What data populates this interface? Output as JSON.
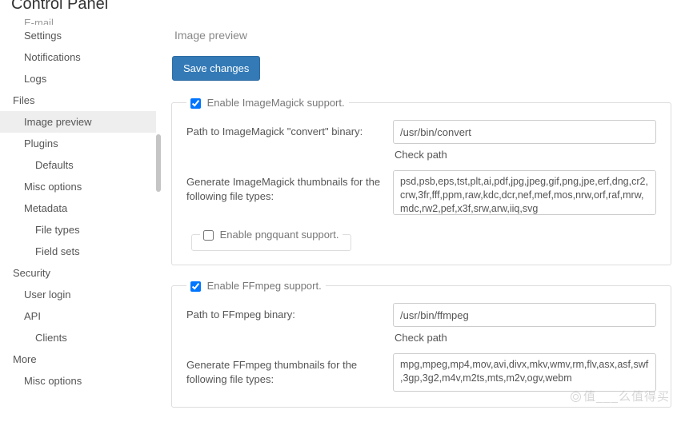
{
  "page": {
    "title": "Control Panel",
    "section": "Image preview"
  },
  "sidebar": {
    "items": [
      {
        "label": "E-mail",
        "kind": "sub",
        "cut": true
      },
      {
        "label": "Settings",
        "kind": "sub"
      },
      {
        "label": "Notifications",
        "kind": "sub"
      },
      {
        "label": "Logs",
        "kind": "sub"
      },
      {
        "label": "Files",
        "kind": "head"
      },
      {
        "label": "Image preview",
        "kind": "sub",
        "active": true
      },
      {
        "label": "Plugins",
        "kind": "sub"
      },
      {
        "label": "Defaults",
        "kind": "sub2"
      },
      {
        "label": "Misc options",
        "kind": "sub"
      },
      {
        "label": "Metadata",
        "kind": "sub"
      },
      {
        "label": "File types",
        "kind": "sub2"
      },
      {
        "label": "Field sets",
        "kind": "sub2"
      },
      {
        "label": "Security",
        "kind": "head"
      },
      {
        "label": "User login",
        "kind": "sub"
      },
      {
        "label": "API",
        "kind": "sub"
      },
      {
        "label": "Clients",
        "kind": "sub2"
      },
      {
        "label": "More",
        "kind": "head"
      },
      {
        "label": "Misc options",
        "kind": "sub"
      }
    ]
  },
  "actions": {
    "save": "Save changes"
  },
  "groups": {
    "imagemagick": {
      "legend": "Enable ImageMagick support.",
      "enabled": true,
      "path_label": "Path to ImageMagick \"convert\" binary:",
      "path_value": "/usr/bin/convert",
      "check_link": "Check path",
      "types_label": "Generate ImageMagick thumbnails for the following file types:",
      "types_value": "psd,psb,eps,tst,plt,ai,pdf,jpg,jpeg,gif,png,jpe,erf,dng,cr2,crw,3fr,fff,ppm,raw,kdc,dcr,nef,mef,mos,nrw,orf,raf,mrw,mdc,rw2,pef,x3f,srw,arw,iiq,svg",
      "pngquant_legend": "Enable pngquant support.",
      "pngquant_enabled": false
    },
    "ffmpeg": {
      "legend": "Enable FFmpeg support.",
      "enabled": true,
      "path_label": "Path to FFmpeg binary:",
      "path_value": "/usr/bin/ffmpeg",
      "check_link": "Check path",
      "types_label": "Generate FFmpeg thumbnails for the following file types:",
      "types_value": "mpg,mpeg,mp4,mov,avi,divx,mkv,wmv,rm,flv,asx,asf,swf,3gp,3g2,m4v,m2ts,mts,m2v,ogv,webm"
    }
  },
  "watermark": "值___么值得买"
}
